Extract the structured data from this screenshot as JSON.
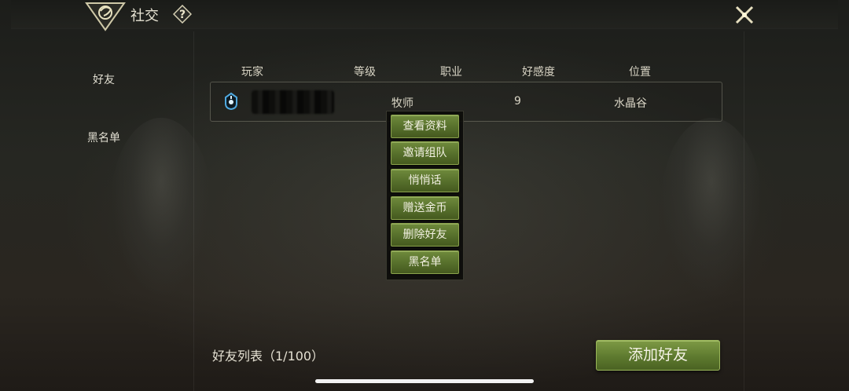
{
  "header": {
    "title": "社交"
  },
  "sidebar": {
    "items": [
      {
        "label": "好友"
      },
      {
        "label": "黑名单"
      }
    ]
  },
  "table": {
    "columns": [
      "玩家",
      "等级",
      "职业",
      "好感度",
      "位置"
    ],
    "rows": [
      {
        "player": "",
        "level": "",
        "class": "牧师",
        "affinity": "9",
        "location": "水晶谷"
      }
    ]
  },
  "context_menu": {
    "items": [
      {
        "label": "查看资料"
      },
      {
        "label": "邀请组队"
      },
      {
        "label": "悄悄话"
      },
      {
        "label": "赠送金币"
      },
      {
        "label": "删除好友"
      },
      {
        "label": "黑名单"
      }
    ]
  },
  "footer": {
    "count_label": "好友列表（1/100）",
    "add_button": "添加好友"
  },
  "icons": {
    "logo": "dragon-emblem-icon",
    "help": "question-icon",
    "close": "crossed-swords-close-icon",
    "class_icon": "priest-class-icon"
  },
  "colors": {
    "accent_green": "#5e7a2f",
    "class_icon": "#4fa9e0"
  }
}
